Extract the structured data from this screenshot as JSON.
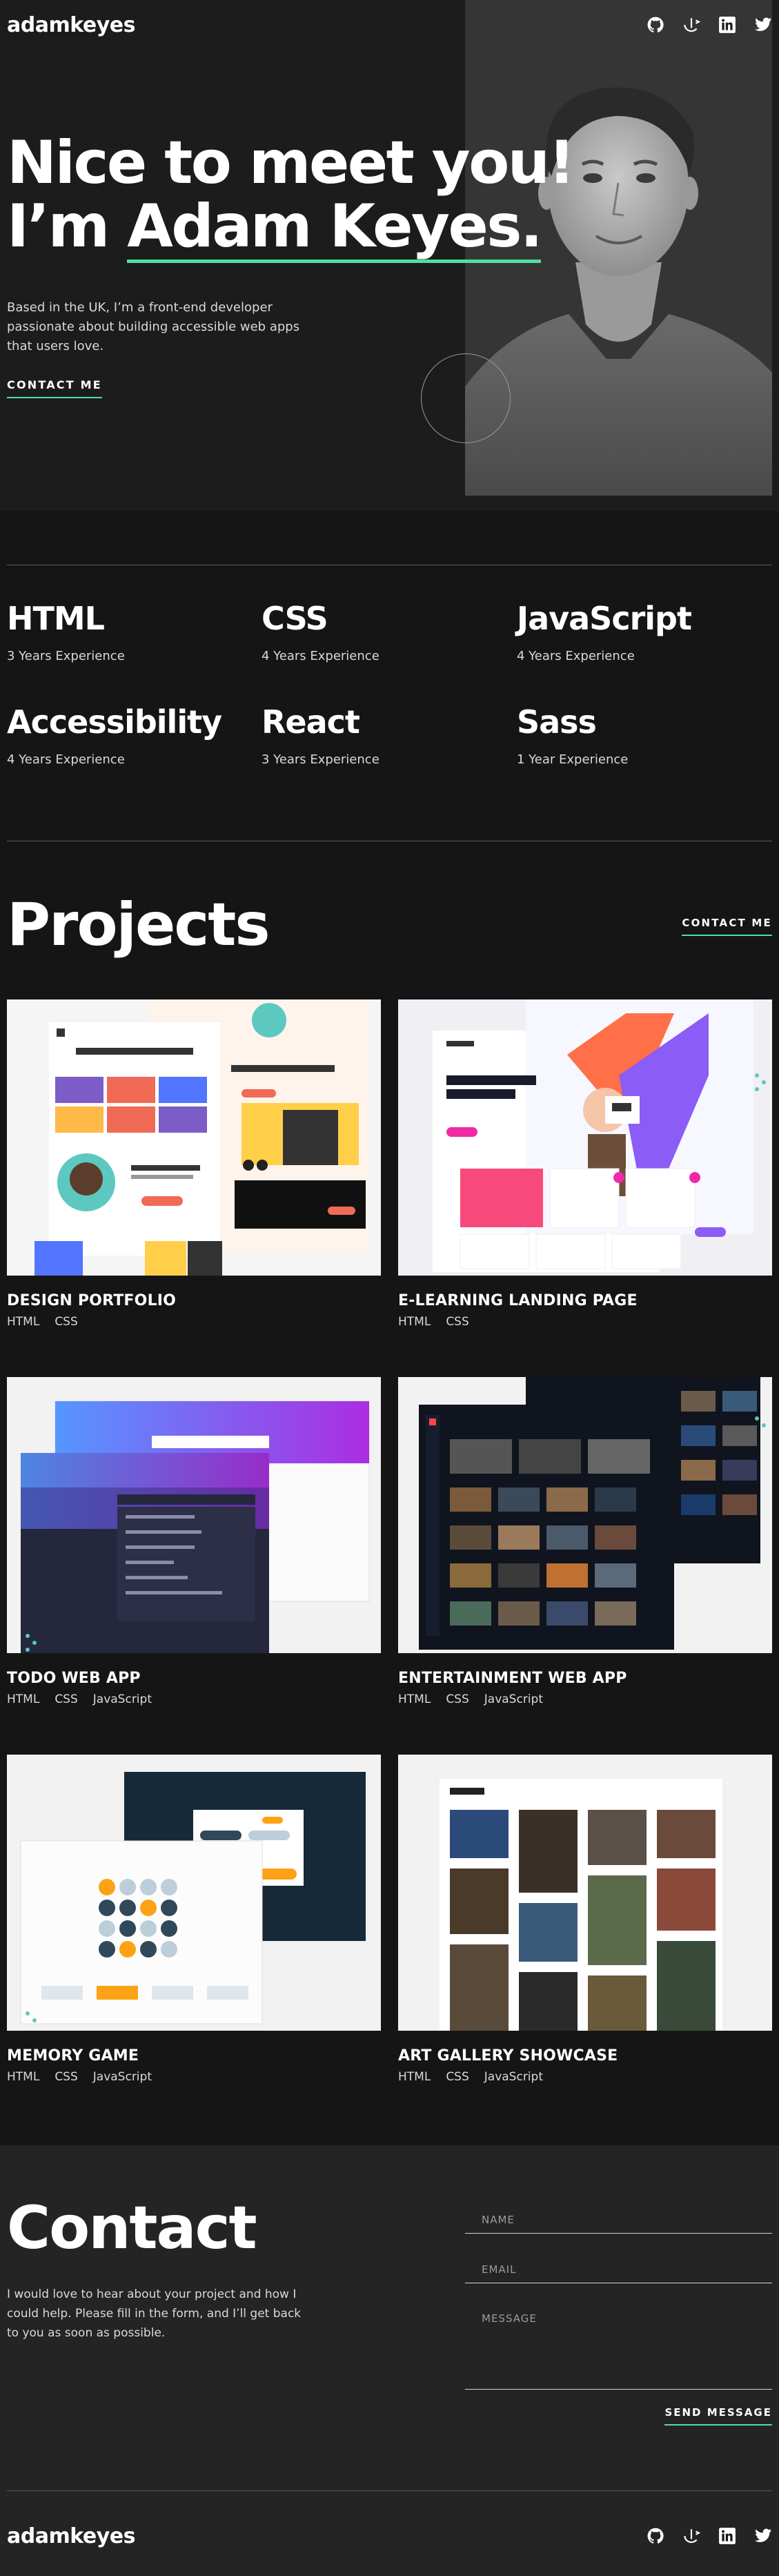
{
  "header": {
    "logo": "adamkeyes",
    "social": [
      {
        "icon": "github-icon"
      },
      {
        "icon": "frontend-mentor-icon"
      },
      {
        "icon": "linkedin-icon"
      },
      {
        "icon": "twitter-icon"
      }
    ]
  },
  "hero": {
    "title_line1": "Nice to meet you!",
    "title_prefix": "I’m ",
    "title_name": "Adam Keyes.",
    "description": "Based in the UK, I’m a front-end developer passionate about building accessible web apps that users love.",
    "contact_label": "CONTACT ME"
  },
  "skills": [
    {
      "name": "HTML",
      "experience": "3 Years Experience"
    },
    {
      "name": "CSS",
      "experience": "4 Years Experience"
    },
    {
      "name": "JavaScript",
      "experience": "4 Years Experience"
    },
    {
      "name": "Accessibility",
      "experience": "4 Years Experience"
    },
    {
      "name": "React",
      "experience": "3 Years Experience"
    },
    {
      "name": "Sass",
      "experience": "1 Year Experience"
    }
  ],
  "projects": {
    "title": "Projects",
    "contact_label": "CONTACT ME",
    "items": [
      {
        "name": "DESIGN PORTFOLIO",
        "tags": [
          "HTML",
          "CSS"
        ]
      },
      {
        "name": "E-LEARNING LANDING PAGE",
        "tags": [
          "HTML",
          "CSS"
        ]
      },
      {
        "name": "TODO WEB APP",
        "tags": [
          "HTML",
          "CSS",
          "JavaScript"
        ]
      },
      {
        "name": "ENTERTAINMENT WEB APP",
        "tags": [
          "HTML",
          "CSS",
          "JavaScript"
        ]
      },
      {
        "name": "MEMORY GAME",
        "tags": [
          "HTML",
          "CSS",
          "JavaScript"
        ]
      },
      {
        "name": "ART GALLERY SHOWCASE",
        "tags": [
          "HTML",
          "CSS",
          "JavaScript"
        ]
      }
    ]
  },
  "contact": {
    "title": "Contact",
    "description": "I would love to hear about your project and how I could help. Please fill in the form, and I’ll get back to you as soon as possible.",
    "name_placeholder": "NAME",
    "email_placeholder": "EMAIL",
    "message_placeholder": "MESSAGE",
    "send_label": "SEND MESSAGE"
  },
  "footer": {
    "logo": "adamkeyes"
  },
  "colors": {
    "accent": "#4ee1a0",
    "background": "#151515",
    "section_bg": "#242424"
  }
}
